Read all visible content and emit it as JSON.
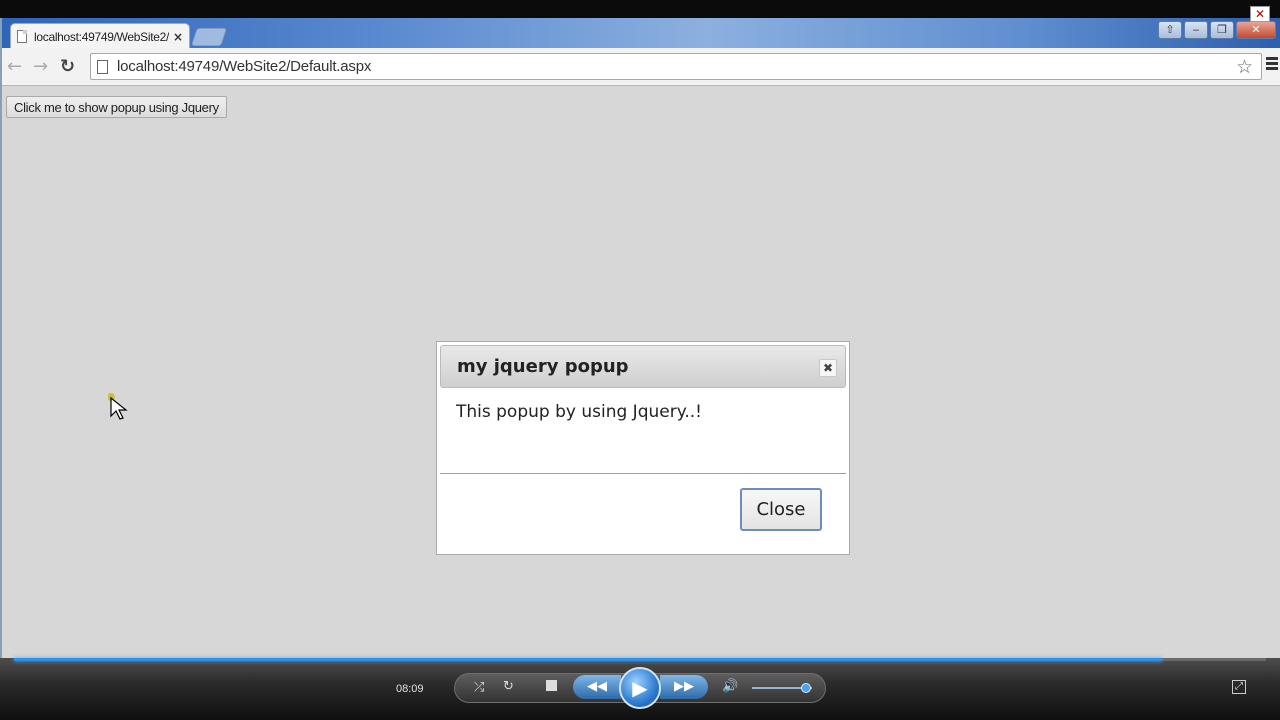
{
  "browser": {
    "tab": {
      "title": "localhost:49749/WebSite2/",
      "close": "×"
    },
    "window_controls": {
      "minimize": "‒",
      "restore": "❐",
      "close": "✕",
      "extra": "⇧"
    },
    "nav": {
      "back": "←",
      "forward": "→",
      "reload": "↻"
    },
    "address": {
      "url": "localhost:49749/WebSite2/Default.aspx"
    },
    "star": "☆"
  },
  "page": {
    "show_button_label": "Click me to show popup using Jquery"
  },
  "dialog": {
    "title": "my jquery popup",
    "close_x": "✖",
    "message": "This popup by using Jquery..!",
    "close_button_label": "Close"
  },
  "player": {
    "time": "08:09",
    "seek_progress": 0.917,
    "volume_level": 0.9,
    "shuffle": "⤮",
    "repeat": "↻",
    "prev": "◀◀",
    "play": "▶",
    "next": "▶▶",
    "volume": "🔊",
    "fullscreen": "⤢",
    "close": "✕"
  },
  "colors": {
    "accent": "#2f8fe0",
    "page_background": "#d7d7d7"
  },
  "icons": [
    "page-icon",
    "close-icon",
    "back-arrow-icon",
    "forward-arrow-icon",
    "reload-icon",
    "star-icon",
    "menu-icon",
    "cursor-icon",
    "play-icon",
    "volume-icon"
  ]
}
